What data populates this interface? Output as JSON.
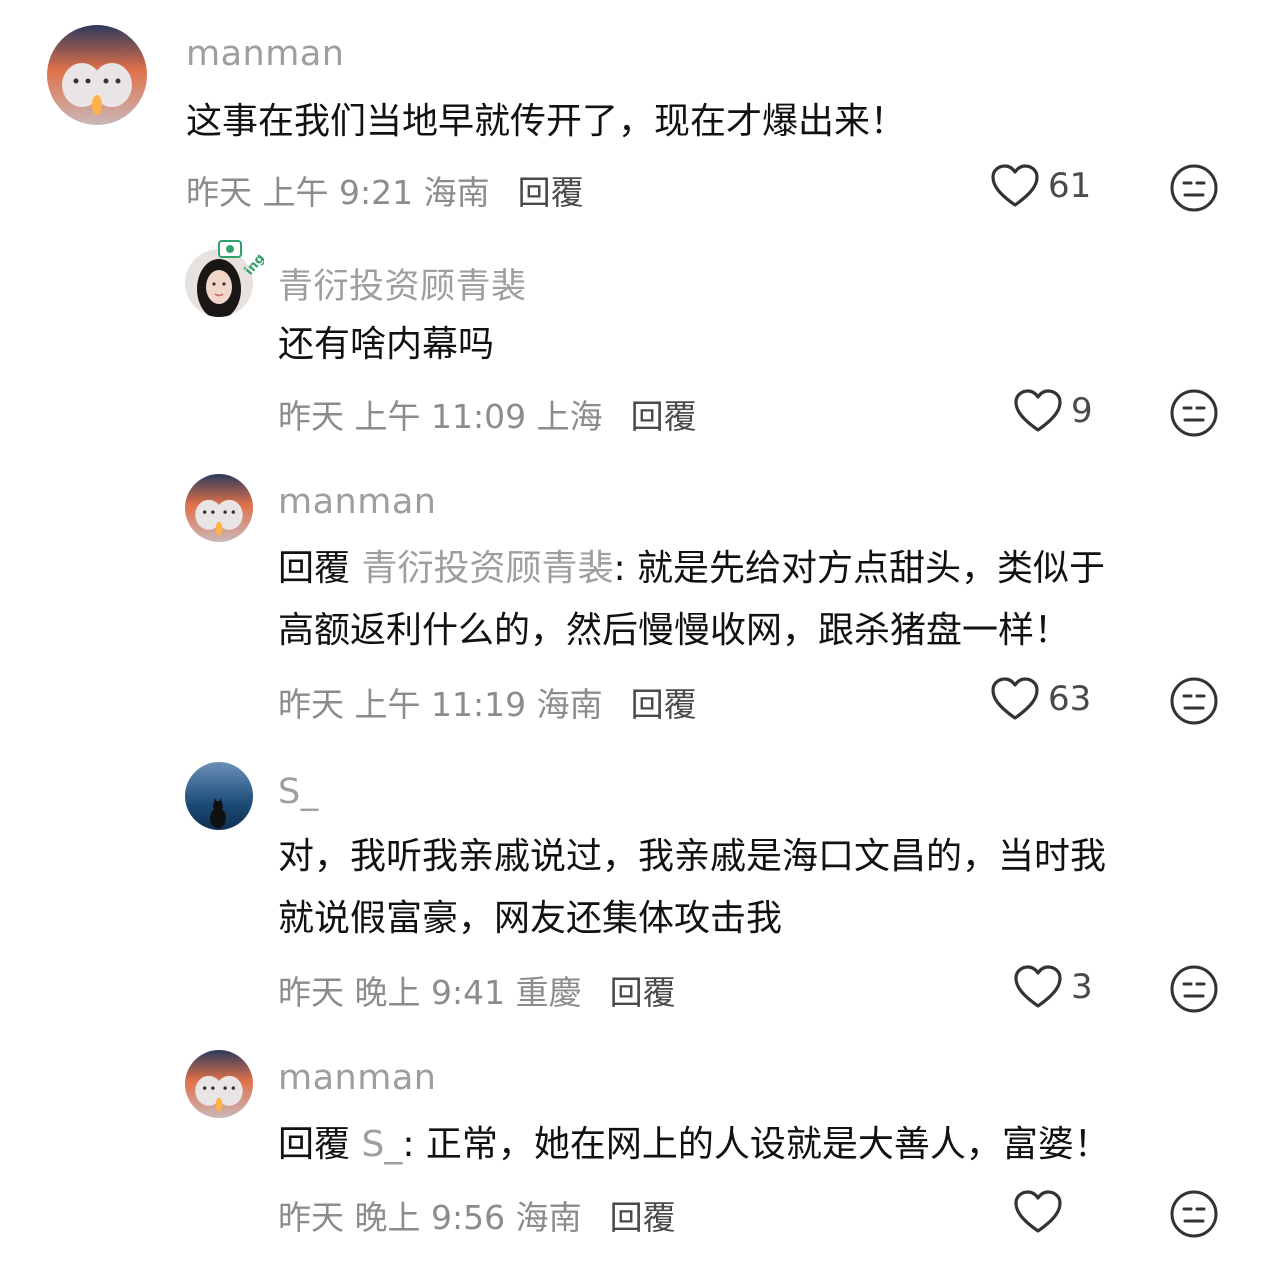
{
  "comments": [
    {
      "username": "manman",
      "lines": [
        "这事在我们当地早就传开了，现在才爆出来！"
      ],
      "time": "昨天 上午 9:21 海南",
      "reply_label": "回覆",
      "likes": "61"
    },
    {
      "username": "青衍投资顾青裴",
      "lines": [
        "还有啥内幕吗"
      ],
      "time": "昨天 上午 11:09 上海",
      "reply_label": "回覆",
      "likes": "9"
    },
    {
      "username": "manman",
      "reply_prefix": "回覆",
      "reply_target": "青衍投资顾青裴",
      "lines": [
        ": 就是先给对方点甜头，类似于",
        "高额返利什么的，然后慢慢收网，跟杀猪盘一样！"
      ],
      "time": "昨天 上午 11:19 海南",
      "reply_label": "回覆",
      "likes": "63"
    },
    {
      "username": "S_",
      "lines": [
        "对，我听我亲戚说过，我亲戚是海口文昌的，当时我",
        "就说假富豪，网友还集体攻击我"
      ],
      "time": "昨天 晚上 9:41 重慶",
      "reply_label": "回覆",
      "likes": "3"
    },
    {
      "username": "manman",
      "reply_prefix": "回覆",
      "reply_target": "S_",
      "lines": [
        ": 正常，她在网上的人设就是大善人，富婆！"
      ],
      "time": "昨天 晚上 9:56 海南",
      "reply_label": "回覆",
      "likes": ""
    }
  ],
  "icons": {
    "like": "heart-outline-icon",
    "dislike": "neutral-face-icon"
  }
}
